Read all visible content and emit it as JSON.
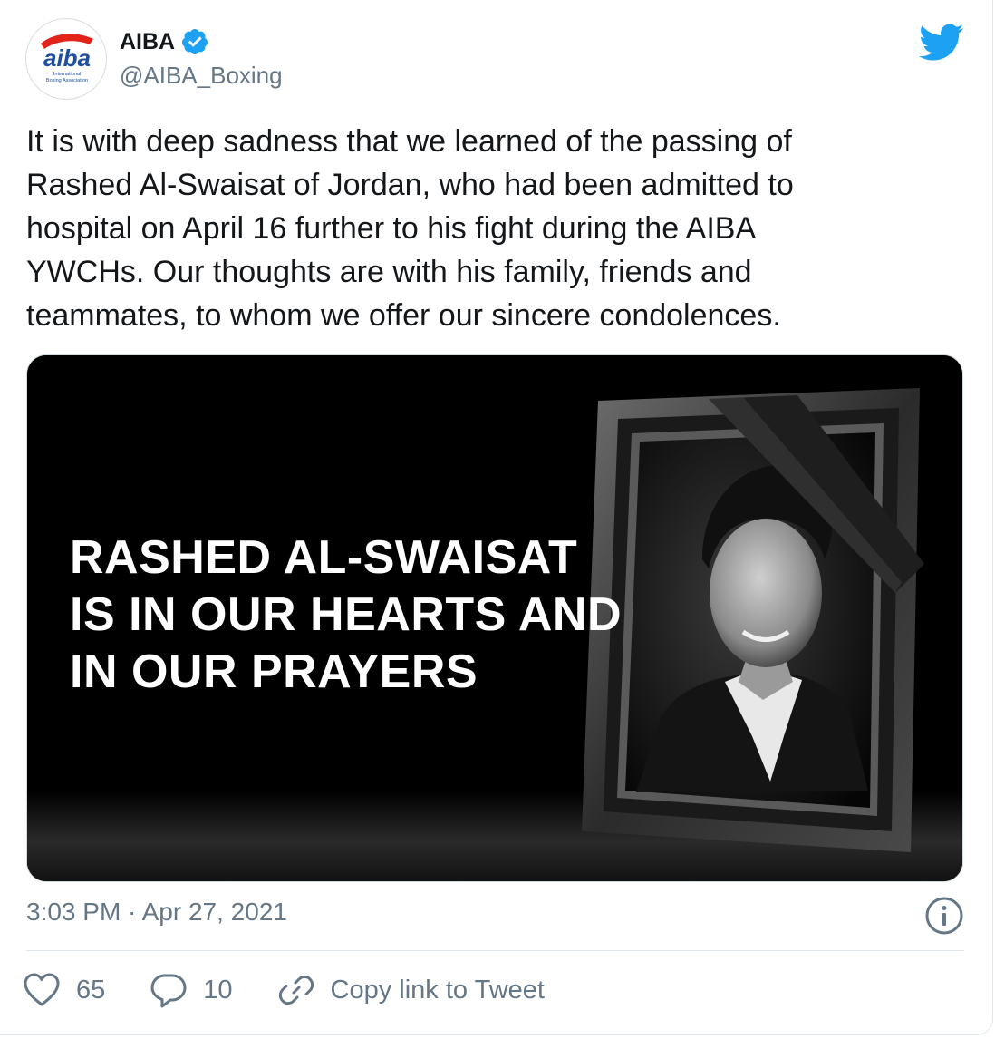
{
  "author": {
    "display_name": "AIBA",
    "handle": "@AIBA_Boxing",
    "verified": true,
    "avatar_logo": {
      "wordmark": "aiba",
      "line1": "International",
      "line2": "Boxing Association"
    }
  },
  "tweet": {
    "text": "It is with deep sadness that we learned of the passing of\nRashed Al-Swaisat of Jordan, who had been admitted to\nhospital on April 16 further to his fight during the AIBA\nYWCHs. Our thoughts are with his family, friends and\nteammates, to whom we offer our sincere condolences.",
    "timestamp": "3:03 PM · Apr 27, 2021"
  },
  "media": {
    "caption_lines": [
      "RASHED AL-SWAISAT",
      "IS IN OUR HEARTS AND",
      "IN OUR PRAYERS"
    ]
  },
  "actions": {
    "likes": "65",
    "replies": "10",
    "copy_link_label": "Copy link to Tweet"
  },
  "icons": {
    "brand": "twitter-bird-icon",
    "verified": "verified-badge-icon",
    "info": "info-icon",
    "like": "heart-icon",
    "reply": "reply-bubble-icon",
    "link": "link-icon"
  },
  "colors": {
    "twitter_blue": "#1da1f2",
    "secondary_text": "#657786",
    "aiba_red": "#e2231a",
    "aiba_blue": "#1f4fa3"
  }
}
